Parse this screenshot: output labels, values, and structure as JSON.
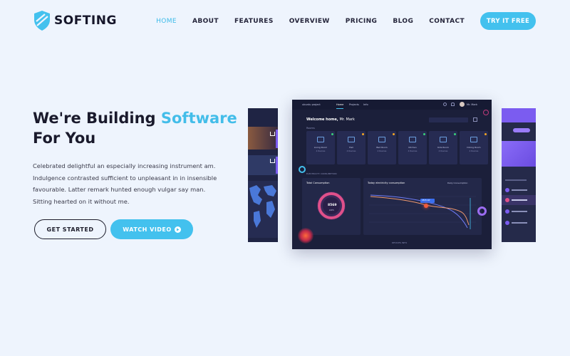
{
  "brand": {
    "name": "SOFTING",
    "logo_icon": "shield-icon",
    "accent": "#43c1ee"
  },
  "nav": {
    "items": [
      {
        "label": "HOME",
        "active": true
      },
      {
        "label": "ABOUT",
        "active": false
      },
      {
        "label": "FEATURES",
        "active": false
      },
      {
        "label": "OVERVIEW",
        "active": false
      },
      {
        "label": "PRICING",
        "active": false
      },
      {
        "label": "BLOG",
        "active": false
      },
      {
        "label": "CONTACT",
        "active": false
      }
    ],
    "cta_label": "TRY IT FREE"
  },
  "hero": {
    "title_part1": "We're Building ",
    "title_highlight": "Software",
    "title_part2": "For You",
    "description": "Celebrated delightful an especially increasing instrument am. Indulgence contrasted sufficient to unpleasant in in insensible favourable. Latter remark hunted enough vulgar say man. Sitting hearted on it without me.",
    "primary_button": "GET STARTED",
    "secondary_button": "WATCH VIDEO",
    "secondary_icon": "play-icon"
  },
  "dashboard": {
    "brand": "ubuntu project",
    "tabs": [
      "Home",
      "Projects",
      "Info"
    ],
    "user": "Mr. Mark",
    "welcome_prefix": "Welcome home,",
    "welcome_name": "Mr. Mark",
    "section_label": "Rooms",
    "rooms": [
      {
        "name": "Living Room",
        "value": "4 Devices",
        "status": "#3ad07a"
      },
      {
        "name": "Hall",
        "value": "4 Devices",
        "status": "#f5a623"
      },
      {
        "name": "Bed Room",
        "value": "4 Devices",
        "status": "#f5a623"
      },
      {
        "name": "Kitchen",
        "value": "4 Devices",
        "status": "#3ad07a"
      },
      {
        "name": "Kids Room",
        "value": "4 Devices",
        "status": "#3ad07a"
      },
      {
        "name": "Dining Room",
        "value": "4 Devices",
        "status": "#f5a623"
      }
    ],
    "consumption_label": "ELECTRICITY CONSUMPTION",
    "total_label": "Total Consumption",
    "total_value": "8569",
    "total_unit": "kWh",
    "chart_title": "Today electricity consumption",
    "chart_sub": "Daily Consumption",
    "chart_badge": "2845 kW",
    "devices_label": "DEVICES INFO"
  }
}
